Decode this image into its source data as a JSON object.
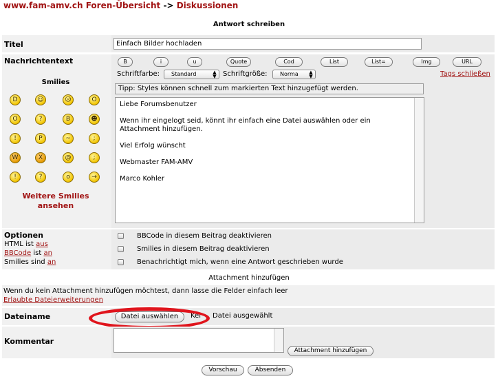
{
  "breadcrumb": {
    "site": "www.fam-amv.ch",
    "forum": "Foren-Übersicht",
    "separator": "->",
    "current": "Diskussionen"
  },
  "form_title": "Antwort schreiben",
  "title_row": {
    "label": "Titel",
    "value": "Einfach Bilder hochladen"
  },
  "message_row": {
    "label": "Nachrichtentext",
    "bbcode_buttons": [
      "B",
      "i",
      "u",
      "Quote",
      "Cod",
      "List",
      "List=",
      "Img",
      "URL"
    ],
    "close_tags": "Tags schließen",
    "font_color_label": "Schriftfarbe:",
    "font_color_value": "Standard",
    "font_size_label": "Schriftgröße:",
    "font_size_value": "Norma",
    "tip": "Tipp: Styles können schnell zum markierten Text hinzugefügt werden.",
    "body_lines": [
      "Liebe Forumsbenutzer",
      "",
      "Wenn ihr eingelogt seid, könnt ihr einfach eine Datei auswählen oder ein",
      "Attachment hinzufügen.",
      "",
      "Viel Erfolg wünscht",
      "",
      "Webmaster FAM-AMV",
      "",
      "Marco Kohler"
    ]
  },
  "smilies": {
    "heading": "Smilies",
    "icons": [
      "grin-icon",
      "happy-icon",
      "sad-icon",
      "surprised-icon",
      "shocked-icon",
      "confused-icon",
      "cool-icon",
      "laughing-icon",
      "mad-icon",
      "razz-icon",
      "embarrassed-icon",
      "crying-icon",
      "evil-icon",
      "twisted-evil-icon",
      "rolling-eyes-icon",
      "wink-icon",
      "exclaim-icon",
      "question-icon",
      "idea-icon",
      "arrow-icon"
    ],
    "more_line1": "Weitere Smilies",
    "more_line2": "ansehen"
  },
  "options": {
    "heading": "Optionen",
    "html_prefix": "HTML ist",
    "html_value": "aus",
    "bbcode_link": "BBCode",
    "bbcode_mid": "ist",
    "bbcode_value": "an",
    "smilies_prefix": "Smilies sind",
    "smilies_value": "an",
    "checkboxes": [
      "BBCode in diesem Beitrag deaktivieren",
      "Smilies in diesem Beitrag deaktivieren",
      "Benachrichtigt mich, wenn eine Antwort geschrieben wurde"
    ]
  },
  "attachment": {
    "heading": "Attachment hinzufügen",
    "info": "Wenn du kein Attachment hinzufügen möchtest, dann lasse die Felder einfach leer",
    "allowed_link": "Erlaubte Dateierweiterungen",
    "filename_label": "Dateiname",
    "choose_file": "Datei auswählen",
    "no_file_prefix": "Kei",
    "no_file_suffix": "Datei ausgewählt",
    "comment_label": "Kommentar",
    "add_button": "Attachment hinzufügen"
  },
  "actions": {
    "preview": "Vorschau",
    "submit": "Absenden"
  },
  "colors": {
    "link_red": "#a11414",
    "highlight_red": "#e0141c",
    "row_bg": "#f1f1f1"
  }
}
